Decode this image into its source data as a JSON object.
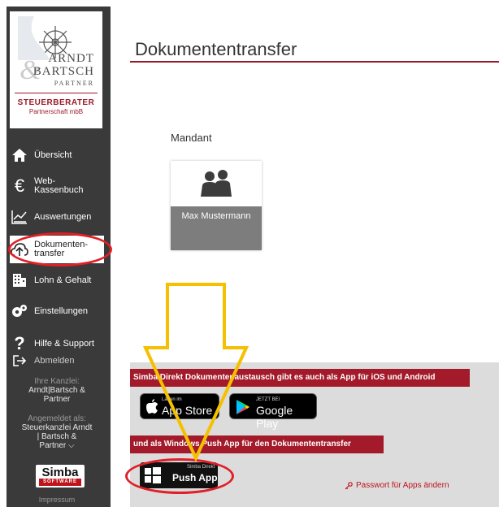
{
  "sidebar": {
    "logo": {
      "name_line1": "ARNDT",
      "name_line2": "BARTSCH",
      "amp": "&",
      "partner": "PARTNER",
      "steuerberater": "STEUERBERATER",
      "partnerschaft": "Partnerschaft mbB"
    },
    "items": [
      {
        "label": "Übersicht",
        "icon": "home-icon"
      },
      {
        "label_line1": "Web-",
        "label_line2": "Kassenbuch",
        "icon": "euro-icon"
      },
      {
        "label": "Auswertungen",
        "icon": "chart-icon"
      },
      {
        "label_line1": "Dokumenten-",
        "label_line2": "transfer",
        "icon": "upload-cloud-icon"
      },
      {
        "label": "Lohn & Gehalt",
        "icon": "building-icon"
      },
      {
        "label": "Einstellungen",
        "icon": "gears-icon"
      },
      {
        "label": "Hilfe & Support",
        "icon": "question-icon"
      },
      {
        "label": "Abmelden",
        "icon": "logout-icon"
      }
    ],
    "kanzlei": {
      "label": "Ihre Kanzlei:",
      "value_line1": "Arndt|Bartsch &",
      "value_line2": "Partner"
    },
    "angemeldet": {
      "label": "Angemeldet als:",
      "value_line1": "Steuerkanzlei Arndt",
      "value_line2": "| Bartsch &",
      "value_line3": "Partner ⌵"
    },
    "simba": {
      "top": "Simba",
      "bottom": "SOFTWARE"
    },
    "impressum": "Impressum"
  },
  "main": {
    "title": "Dokumententransfer",
    "mandant_label": "Mandant",
    "mandant_card": {
      "name": "Max Mustermann",
      "icon": "users-icon"
    },
    "apps": {
      "bar1": "Simba Direkt Dokumentenaustausch gibt es auch als App für iOS und Android",
      "appstore": {
        "small": "Laden im",
        "big": "App Store",
        "icon": "apple-icon"
      },
      "googleplay": {
        "small": "JETZT BEI",
        "big": "Google Play",
        "icon": "play-icon"
      },
      "bar2": "und als Windows Push App für den Dokumententransfer",
      "pushapp": {
        "small": "Simba Direkt",
        "big": "Push App",
        "icon": "windows-icon"
      },
      "password_link": "Passwort für Apps ändern"
    }
  },
  "colors": {
    "sidebar_bg": "#3a3a3a",
    "accent_red": "#a31a2a",
    "annotation_red": "#e01f26",
    "arrow_yellow": "#f5c000"
  }
}
